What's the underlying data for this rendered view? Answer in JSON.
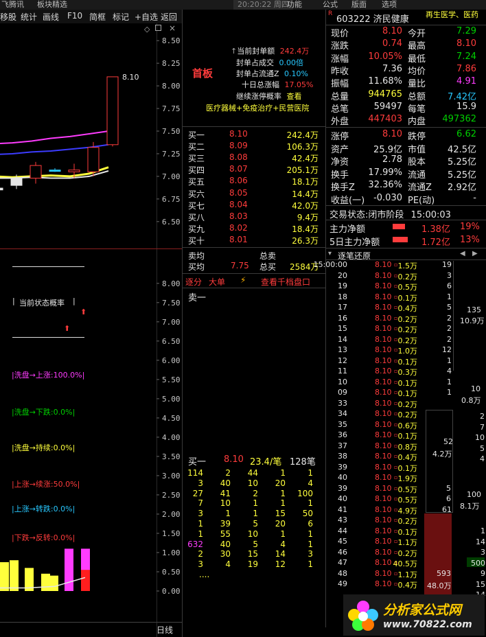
{
  "topbar": {
    "left_title": "飞腾讯",
    "left_sub": "板块精选",
    "clock": "20:20:22 周四",
    "menu": [
      "功能",
      "公式",
      "版面",
      "选项"
    ]
  },
  "toolbar": {
    "items": [
      "移股",
      "统计",
      "画线",
      "F10",
      "简框",
      "标记",
      "+自选",
      "返回"
    ]
  },
  "chart_data": [
    {
      "type": "candlestick",
      "title": "",
      "y_ticks": [
        "8.50",
        "8.25",
        "8.00",
        "7.75",
        "7.50",
        "7.25",
        "7.00",
        "6.75",
        "6.50"
      ],
      "ylim": [
        6.4,
        8.6
      ],
      "last_label": "8.10",
      "candles": [
        {
          "o": 6.85,
          "c": 6.87,
          "h": 6.9,
          "l": 6.78,
          "color": "white"
        },
        {
          "o": 6.9,
          "c": 6.98,
          "h": 7.02,
          "l": 6.86,
          "color": "white"
        },
        {
          "o": 6.98,
          "c": 7.12,
          "h": 7.16,
          "l": 6.92,
          "color": "red"
        },
        {
          "o": 7.07,
          "c": 7.07,
          "h": 7.09,
          "l": 7.05,
          "color": "cyan"
        },
        {
          "o": 7.07,
          "c": 7.05,
          "h": 7.14,
          "l": 6.98,
          "color": "red"
        },
        {
          "o": 7.05,
          "c": 7.32,
          "h": 7.38,
          "l": 7.0,
          "color": "red"
        },
        {
          "o": 7.35,
          "c": 8.1,
          "h": 8.1,
          "l": 7.33,
          "color": "red"
        }
      ],
      "lines": [
        {
          "color": "#ff3cff",
          "values": [
            7.36,
            7.37,
            7.39,
            7.42,
            7.44,
            7.47,
            7.5
          ]
        },
        {
          "color": "#3c3cff",
          "values": [
            7.24,
            7.25,
            7.27,
            7.28,
            7.3,
            7.32,
            7.35
          ]
        },
        {
          "color": "#ffff3c",
          "values": [
            7.0,
            6.99,
            7.0,
            7.01,
            7.0,
            7.03,
            7.1
          ]
        },
        {
          "color": "#e6e6e6",
          "values": [
            6.98,
            6.98,
            6.99,
            6.98,
            6.98,
            7.0,
            7.06
          ]
        }
      ]
    },
    {
      "type": "bar",
      "title": "",
      "y_ticks": [
        "8.00",
        "7.50",
        "7.00",
        "6.50",
        "6.00",
        "5.50",
        "5.00",
        "4.50",
        "4.00",
        "3.50",
        "3.00",
        "2.50",
        "2.00",
        "1.50",
        "1.00",
        "0.50",
        "0.00"
      ],
      "ylim": [
        0,
        8.3
      ],
      "bars": [
        {
          "value": 0.75,
          "color": "#ffff3c"
        },
        {
          "value": 0.8,
          "color": "#ffff3c"
        },
        {
          "value": 0.6,
          "color": "#ffff3c"
        },
        {
          "value": 0.45,
          "color": "#ffff3c"
        },
        {
          "value": 0.4,
          "color": "#ffff3c"
        },
        {
          "value": 1.1,
          "color": "#ff3cff"
        },
        {
          "value": 1.1,
          "color": "#ff3cff",
          "lower": 0.55,
          "lower_color": "#ff1e1e"
        }
      ]
    }
  ],
  "indicator": {
    "title": "当前状态概率",
    "rows": [
      {
        "text": "洗盘→上涨:100.0%",
        "color": "#ff3cff"
      },
      {
        "text": "洗盘→下跌:0.0%",
        "color": "#00d000"
      },
      {
        "text": "洗盘→持续:0.0%",
        "color": "#ffff3c"
      },
      {
        "text": "上涨→续涨:50.0%",
        "color": "#ff3c3c"
      },
      {
        "text": "上涨→转跌:0.0%",
        "color": "#28c8ff"
      },
      {
        "text": "下跌→反转:0.0%",
        "color": "#ff3c3c"
      }
    ],
    "period": "日线"
  },
  "limitup": {
    "badge": "首板",
    "seal_amount_label": "当前封单额",
    "seal_amount": "242.4万",
    "seal_vol_ratio_label": "封单占成交",
    "seal_vol_ratio": "0.00倍",
    "seal_float_label": "封单占流通Z",
    "seal_float": "0.10%",
    "ten_day_label": "十日总涨幅",
    "ten_day": "17.05%",
    "cont_prob_label": "继续涨停概率",
    "cont_prob": "查看",
    "concepts": "医疗器械+免疫治疗+民营医院"
  },
  "orderbook": {
    "bids": [
      {
        "name": "买一",
        "price": "8.10",
        "vol": "242.4万"
      },
      {
        "name": "买二",
        "price": "8.09",
        "vol": "106.3万"
      },
      {
        "name": "买三",
        "price": "8.08",
        "vol": "42.4万"
      },
      {
        "name": "买四",
        "price": "8.07",
        "vol": "205.1万"
      },
      {
        "name": "买五",
        "price": "8.06",
        "vol": "18.1万"
      },
      {
        "name": "买六",
        "price": "8.05",
        "vol": "14.4万"
      },
      {
        "name": "买七",
        "price": "8.04",
        "vol": "42.0万"
      },
      {
        "name": "买八",
        "price": "8.03",
        "vol": "9.4万"
      },
      {
        "name": "买九",
        "price": "8.02",
        "vol": "18.4万"
      },
      {
        "name": "买十",
        "price": "8.01",
        "vol": "26.3万"
      }
    ],
    "sell_avg_label": "卖均",
    "total_sell_label": "总卖",
    "buy_avg_label": "买均",
    "buy_avg": "7.75",
    "total_buy_label": "总买",
    "total_buy": "2584万",
    "tabs": [
      "逐分",
      "大单",
      "查看千档盘口"
    ],
    "ask1_label": "卖一",
    "bid1_label": "买一",
    "bid1_price": "8.10",
    "bid1_avg": "23.4/笔",
    "bid1_count": "128笔",
    "queue": [
      [
        "114",
        "2",
        "44",
        "1",
        "1"
      ],
      [
        "3",
        "40",
        "10",
        "20",
        "4"
      ],
      [
        "27",
        "41",
        "2",
        "1",
        "100"
      ],
      [
        "7",
        "10",
        "1",
        "1",
        "1"
      ],
      [
        "3",
        "1",
        "1",
        "15",
        "50"
      ],
      [
        "1",
        "39",
        "5",
        "20",
        "6"
      ],
      [
        "1",
        "55",
        "10",
        "1",
        "1"
      ],
      [
        "632",
        "40",
        "5",
        "4",
        "1"
      ],
      [
        "2",
        "30",
        "15",
        "14",
        "3"
      ],
      [
        "3",
        "4",
        "19",
        "12",
        "1"
      ]
    ],
    "more": "...."
  },
  "quote": {
    "code": "603222",
    "name": "济民健康",
    "tags": "再生医学、医药",
    "rows": [
      {
        "l1": "现价",
        "v1": "8.10",
        "c1": "#ff3c3c",
        "l2": "今开",
        "v2": "7.29",
        "c2": "#00d000"
      },
      {
        "l1": "涨跌",
        "v1": "0.74",
        "c1": "#ff3c3c",
        "l2": "最高",
        "v2": "8.10",
        "c2": "#ff3c3c"
      },
      {
        "l1": "涨幅",
        "v1": "10.05%",
        "c1": "#ff3c3c",
        "l2": "最低",
        "v2": "7.24",
        "c2": "#00d000"
      },
      {
        "l1": "昨收",
        "v1": "7.36",
        "c1": "#e6e6e6",
        "l2": "均价",
        "v2": "7.86",
        "c2": "#ff3c3c"
      },
      {
        "l1": "振幅",
        "v1": "11.68%",
        "c1": "#e6e6e6",
        "l2": "量比",
        "v2": "4.91",
        "c2": "#ff3cff"
      },
      {
        "l1": "总量",
        "v1": "944765",
        "c1": "#ffff3c",
        "l2": "总额",
        "v2": "7.42亿",
        "c2": "#28c8ff"
      },
      {
        "l1": "总笔",
        "v1": "59497",
        "c1": "#e6e6e6",
        "l2": "每笔",
        "v2": "15.9",
        "c2": "#e6e6e6"
      },
      {
        "l1": "外盘",
        "v1": "447403",
        "c1": "#ff3c3c",
        "l2": "内盘",
        "v2": "497362",
        "c2": "#00d000"
      }
    ],
    "rows2": [
      {
        "l1": "涨停",
        "v1": "8.10",
        "c1": "#ff3c3c",
        "l2": "跌停",
        "v2": "6.62",
        "c2": "#00d000"
      },
      {
        "l1": "资产",
        "v1": "25.9亿",
        "c1": "#e6e6e6",
        "l2": "市值",
        "v2": "42.5亿",
        "c2": "#e6e6e6"
      },
      {
        "l1": "净资",
        "v1": "2.78",
        "c1": "#e6e6e6",
        "l2": "股本",
        "v2": "5.25亿",
        "c2": "#e6e6e6"
      },
      {
        "l1": "换手",
        "v1": "17.99%",
        "c1": "#e6e6e6",
        "l2": "流通",
        "v2": "5.25亿",
        "c2": "#e6e6e6"
      },
      {
        "l1": "换手Z",
        "v1": "32.36%",
        "c1": "#e6e6e6",
        "l2": "流通Z",
        "v2": "2.92亿",
        "c2": "#e6e6e6"
      },
      {
        "l1": "收益(一)",
        "v1": "-0.030",
        "c1": "#e6e6e6",
        "l2": "PE(动)",
        "v2": "-",
        "c2": "#e6e6e6"
      }
    ],
    "trade_status_label": "交易状态:",
    "trade_status": "闭市阶段",
    "trade_time": "15:00:03",
    "main_flow_label": "主力净额",
    "main_flow": "1.38亿",
    "main_flow_pct": "19%",
    "main_flow_5d_label": "5日主力净额",
    "main_flow_5d": "1.72亿",
    "main_flow_5d_pct": "13%",
    "ticks_title": "逐笔还原"
  },
  "ticks": [
    {
      "t": "15:00:00",
      "p": "8.10",
      "v": "1.5万",
      "n": "19"
    },
    {
      "t": "20",
      "p": "8.10",
      "v": "0.2万",
      "n": "3"
    },
    {
      "t": "19",
      "p": "8.10",
      "v": "0.5万",
      "n": "6"
    },
    {
      "t": "18",
      "p": "8.10",
      "v": "0.1万",
      "n": "1"
    },
    {
      "t": "17",
      "p": "8.10",
      "v": "0.4万",
      "n": "5"
    },
    {
      "t": "16",
      "p": "8.10",
      "v": "0.2万",
      "n": "2"
    },
    {
      "t": "15",
      "p": "8.10",
      "v": "0.2万",
      "n": "2"
    },
    {
      "t": "14",
      "p": "8.10",
      "v": "0.2万",
      "n": "2"
    },
    {
      "t": "13",
      "p": "8.10",
      "v": "1.0万",
      "n": "12"
    },
    {
      "t": "12",
      "p": "8.10",
      "v": "0.1万",
      "n": "1"
    },
    {
      "t": "11",
      "p": "8.10",
      "v": "0.3万",
      "n": "4"
    },
    {
      "t": "10",
      "p": "8.10",
      "v": "0.1万",
      "n": "1"
    },
    {
      "t": "09",
      "p": "8.10",
      "v": "0.1万",
      "n": "1"
    },
    {
      "t": "33",
      "p": "8.10",
      "v": "0.2万",
      "n": ""
    },
    {
      "t": "34",
      "p": "8.10",
      "v": "0.2万",
      "n": ""
    },
    {
      "t": "35",
      "p": "8.10",
      "v": "0.6万",
      "n": ""
    },
    {
      "t": "36",
      "p": "8.10",
      "v": "0.1万",
      "n": ""
    },
    {
      "t": "37",
      "p": "8.10",
      "v": "0.8万",
      "n": ""
    },
    {
      "t": "38",
      "p": "8.10",
      "v": "0.4万",
      "n": ""
    },
    {
      "t": "39",
      "p": "8.10",
      "v": "0.1万",
      "n": ""
    },
    {
      "t": "40",
      "p": "8.10",
      "v": "1.9万",
      "n": ""
    },
    {
      "t": "39",
      "p": "8.10",
      "v": "0.5万",
      "n": ""
    },
    {
      "t": "40",
      "p": "8.10",
      "v": "0.5万",
      "n": ""
    },
    {
      "t": "41",
      "p": "8.10",
      "v": "4.9万",
      "n": ""
    },
    {
      "t": "43",
      "p": "8.10",
      "v": "0.2万",
      "n": ""
    },
    {
      "t": "44",
      "p": "8.10",
      "v": "0.1万",
      "n": ""
    },
    {
      "t": "45",
      "p": "8.10",
      "v": "1.1万",
      "n": ""
    },
    {
      "t": "46",
      "p": "8.10",
      "v": "0.2万",
      "n": ""
    },
    {
      "t": "47",
      "p": "8.10",
      "v": "40.5万",
      "n": ""
    },
    {
      "t": "48",
      "p": "8.10",
      "v": "1.1万",
      "n": ""
    },
    {
      "t": "49",
      "p": "8.10",
      "v": "0.4万",
      "n": ""
    }
  ],
  "tick_side": {
    "c1": [
      "135",
      "10.9万"
    ],
    "c2": [
      "10",
      "0.8万"
    ],
    "c3": [
      "52",
      "4.2万"
    ],
    "c4": [
      "5",
      "6",
      "61"
    ],
    "c5": [
      "593",
      "48.0万"
    ],
    "r1": [
      "2",
      "7",
      "10",
      "5",
      "4"
    ],
    "r2": [
      "100",
      "8.1万"
    ],
    "r3": [
      "1",
      "14",
      "3",
      "500",
      "9",
      "15",
      "14"
    ]
  },
  "watermark": {
    "text": "分析家公式网",
    "url": "www.70822.com"
  }
}
